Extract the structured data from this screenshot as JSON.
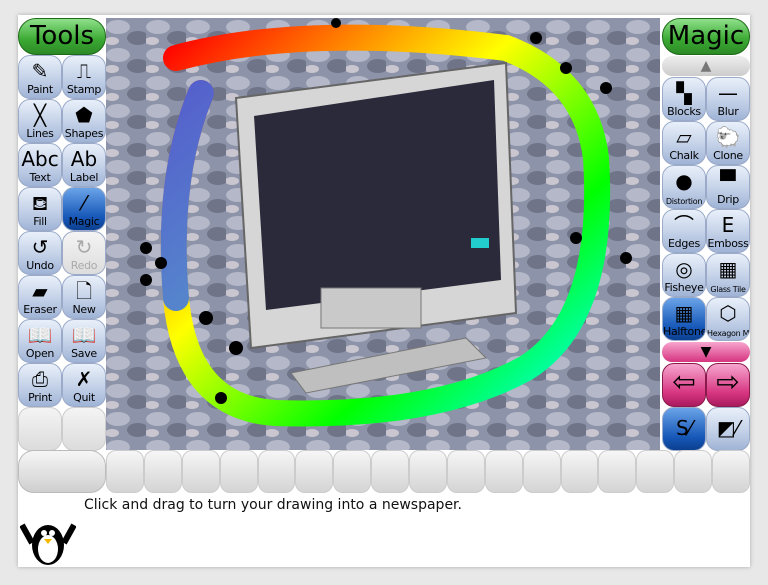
{
  "tools": {
    "title": "Tools",
    "items": [
      {
        "label": "Paint",
        "icon": "✎"
      },
      {
        "label": "Stamp",
        "icon": "⎍"
      },
      {
        "label": "Lines",
        "icon": "╳"
      },
      {
        "label": "Shapes",
        "icon": "⬟"
      },
      {
        "label": "Text",
        "icon": "Abc"
      },
      {
        "label": "Label",
        "icon": "Ab"
      },
      {
        "label": "Fill",
        "icon": "⛾"
      },
      {
        "label": "Magic",
        "icon": "⁄",
        "selected": true
      },
      {
        "label": "Undo",
        "icon": "↺"
      },
      {
        "label": "Redo",
        "icon": "↻",
        "disabled": true
      },
      {
        "label": "Eraser",
        "icon": "▰"
      },
      {
        "label": "New",
        "icon": "🗋"
      },
      {
        "label": "Open",
        "icon": "📖"
      },
      {
        "label": "Save",
        "icon": "📖"
      },
      {
        "label": "Print",
        "icon": "⎙"
      },
      {
        "label": "Quit",
        "icon": "✗"
      }
    ]
  },
  "magic": {
    "title": "Magic",
    "items": [
      {
        "label": "Blocks",
        "icon": "▚"
      },
      {
        "label": "Blur",
        "icon": "—"
      },
      {
        "label": "Chalk",
        "icon": "▱"
      },
      {
        "label": "Clone",
        "icon": "🐑"
      },
      {
        "label": "Distortion",
        "icon": "●"
      },
      {
        "label": "Drip",
        "icon": "▀"
      },
      {
        "label": "Edges",
        "icon": "⌒"
      },
      {
        "label": "Emboss",
        "icon": "E"
      },
      {
        "label": "Fisheye",
        "icon": "◎"
      },
      {
        "label": "Glass Tile",
        "icon": "▦"
      },
      {
        "label": "Halftone",
        "icon": "▦",
        "selected": true
      },
      {
        "label": "Hexagon Mosaic",
        "icon": "⬡"
      }
    ],
    "mode_paint_icon": "paint-mode",
    "mode_full_icon": "fullscreen-mode"
  },
  "status": {
    "message": "Click and drag to turn your drawing into a newspaper."
  },
  "colors": {
    "accent_selected": "#1657b8",
    "header_green": "#3aa832",
    "nav_pink": "#d6337f"
  }
}
